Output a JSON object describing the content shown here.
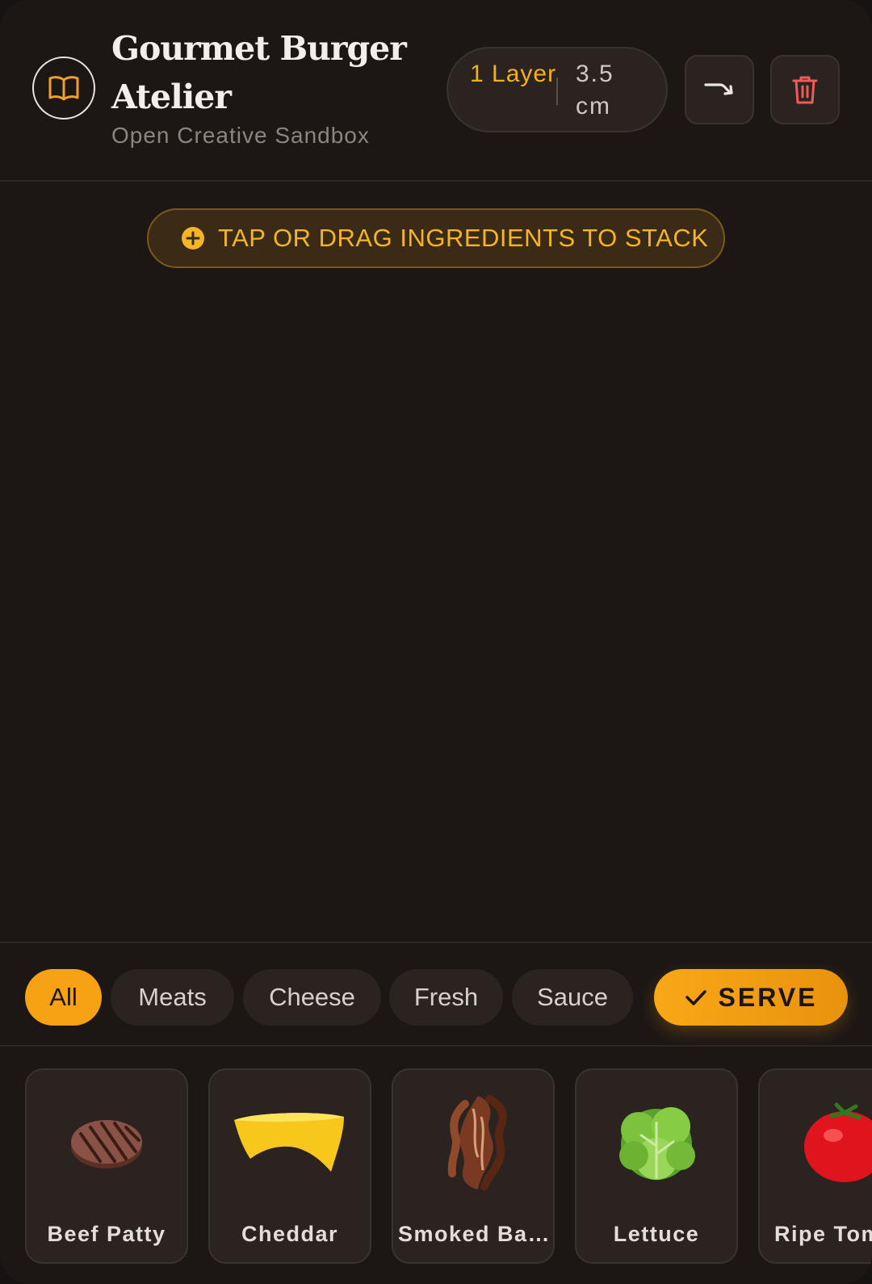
{
  "header": {
    "title": "Gourmet Burger Atelier",
    "subtitle": "Open Creative Sandbox",
    "logo_icon": "book-icon",
    "stats": {
      "layers": "1 Layer",
      "height": "3.5 cm"
    },
    "redo_icon": "redo-arrow-icon",
    "trash_icon": "trash-icon"
  },
  "hint": {
    "icon": "plus-circle-icon",
    "text": "TAP OR DRAG INGREDIENTS TO STACK"
  },
  "filters": [
    {
      "label": "All",
      "active": true
    },
    {
      "label": "Meats",
      "active": false
    },
    {
      "label": "Cheese",
      "active": false
    },
    {
      "label": "Fresh",
      "active": false
    },
    {
      "label": "Sauce",
      "active": false
    }
  ],
  "serve": {
    "label": "SERVE",
    "icon": "check-icon"
  },
  "ingredients": [
    {
      "label": "Beef Patty",
      "icon": "beef-patty-icon"
    },
    {
      "label": "Cheddar",
      "icon": "cheddar-icon"
    },
    {
      "label": "Smoked Ba…",
      "icon": "bacon-icon"
    },
    {
      "label": "Lettuce",
      "icon": "lettuce-icon"
    },
    {
      "label": "Ripe Tomato",
      "icon": "tomato-icon"
    }
  ],
  "colors": {
    "accent": "#f7a212",
    "background": "#1c1715",
    "card": "#2a2320",
    "danger": "#f05a5a"
  }
}
